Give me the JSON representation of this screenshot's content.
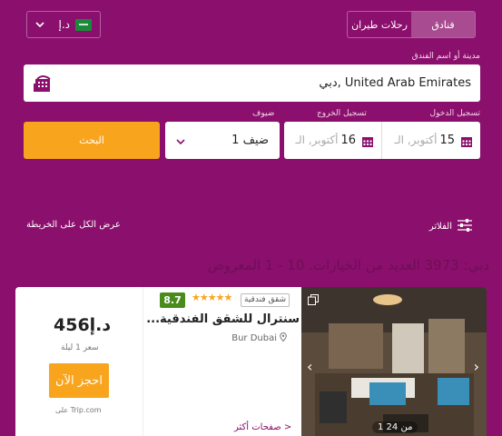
{
  "header": {
    "currency_code": "د.إ",
    "tabs": [
      {
        "label": "رحلات طيران",
        "active": false
      },
      {
        "label": "فنادق",
        "active": true
      }
    ]
  },
  "search": {
    "destination_label": "مدينة أو اسم الفندق",
    "destination_value": "دبي, United Arab Emirates",
    "checkin_label": "تسجيل الدخول",
    "checkin_day": "15",
    "checkin_month": "أكتوبر, الـ",
    "checkout_label": "تسجيل الخروج",
    "checkout_day": "16",
    "checkout_month": "أكتوبر, الـ",
    "guests_label": "ضيوف",
    "guests_value": "1 ضيف",
    "search_button": "البحث"
  },
  "toolbar": {
    "view_map": "عرض الكل على الخريطة",
    "filters": "الفلاتر"
  },
  "results": {
    "heading": "دبي: 3973 العديد من الخيارات. 10 - 1 المعروض"
  },
  "hotel": {
    "rating": "8.7",
    "stars": "★★★★★",
    "category": "شقق فندقية",
    "name": "...سنترال للشقق الفندقية",
    "location": "Bur Dubai",
    "more_pages": "صفحات أكثر >",
    "price": "د.إ456",
    "price_note": "سعر 1 ليلة",
    "book_button": "احجز الآن",
    "provider": "على Trip.com",
    "photo_counter": "1 من 24"
  },
  "colors": {
    "brand": "#8b0f6c",
    "accent": "#f8a41c",
    "rating": "#4a8c1c"
  }
}
